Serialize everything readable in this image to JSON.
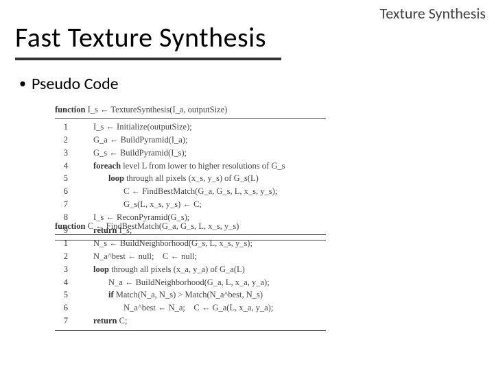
{
  "header": {
    "topright": "Texture Synthesis",
    "title": "Fast Texture Synthesis",
    "bullet": "Pseudo Code"
  },
  "algo1": {
    "signature_kw": "function",
    "signature_rest": " I_s ← TextureSynthesis(I_a, outputSize)",
    "lines": [
      {
        "n": "1",
        "indent": 1,
        "bold": "",
        "text": "I_s ← Initialize(outputSize);"
      },
      {
        "n": "2",
        "indent": 1,
        "bold": "",
        "text": "G_a ← BuildPyramid(I_a);"
      },
      {
        "n": "3",
        "indent": 1,
        "bold": "",
        "text": "G_s ← BuildPyramid(I_s);"
      },
      {
        "n": "4",
        "indent": 1,
        "bold": "foreach",
        "text": " level L from lower to higher resolutions of G_s"
      },
      {
        "n": "5",
        "indent": 2,
        "bold": "loop",
        "text": " through all pixels (x_s, y_s) of G_s(L)"
      },
      {
        "n": "6",
        "indent": 3,
        "bold": "",
        "text": "C ← FindBestMatch(G_a, G_s, L, x_s, y_s);"
      },
      {
        "n": "7",
        "indent": 3,
        "bold": "",
        "text": "G_s(L, x_s, y_s) ← C;"
      },
      {
        "n": "8",
        "indent": 1,
        "bold": "",
        "text": "I_s ← ReconPyramid(G_s);"
      },
      {
        "n": "9",
        "indent": 1,
        "bold": "return",
        "text": " I_s;"
      }
    ]
  },
  "algo2": {
    "signature_kw": "function",
    "signature_rest": " C ← FindBestMatch(G_a, G_s, L, x_s, y_s)",
    "lines": [
      {
        "n": "1",
        "indent": 1,
        "bold": "",
        "text": "N_s ← BuildNeighborhood(G_s, L, x_s, y_s);"
      },
      {
        "n": "2",
        "indent": 1,
        "bold": "",
        "text": "N_a^best ← null;    C ← null;"
      },
      {
        "n": "3",
        "indent": 1,
        "bold": "loop",
        "text": " through all pixels (x_a, y_a) of G_a(L)"
      },
      {
        "n": "4",
        "indent": 2,
        "bold": "",
        "text": "N_a ← BuildNeighborhood(G_a, L, x_a, y_a);"
      },
      {
        "n": "5",
        "indent": 2,
        "bold": "if",
        "text": " Match(N_a, N_s) > Match(N_a^best, N_s)"
      },
      {
        "n": "6",
        "indent": 3,
        "bold": "",
        "text": "N_a^best ← N_a;    C ← G_a(L, x_a, y_a);"
      },
      {
        "n": "7",
        "indent": 1,
        "bold": "return",
        "text": " C;"
      }
    ]
  }
}
